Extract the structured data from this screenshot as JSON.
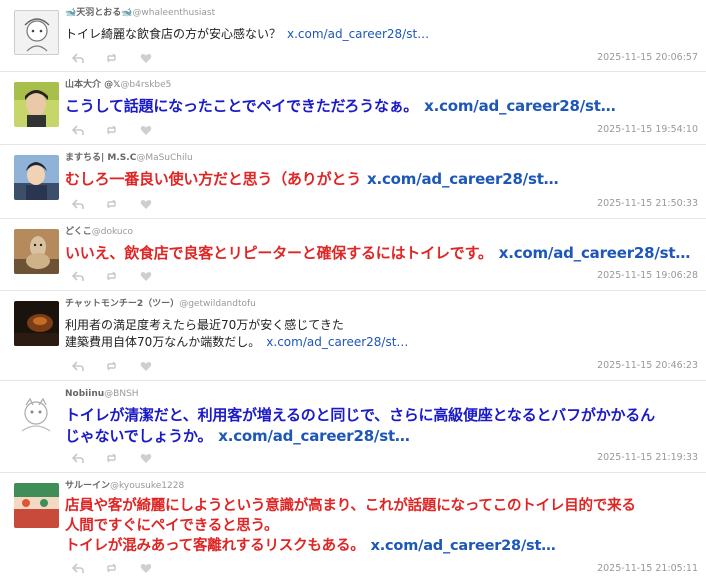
{
  "tweets": [
    {
      "display_name": "🐋天羽とおる🐋",
      "handle": "@whaleenthusiast",
      "lines": [
        "トイレ綺麗な飲食店の方が安心感ない？"
      ],
      "link": "x.com/ad_career28/st…",
      "timestamp": "2025-11-15 20:06:57"
    },
    {
      "display_name": "山本大介 @𝕏",
      "handle": "@b4rskbe5",
      "lines": [
        "こうして話題になったことでペイできただろうなぁ。"
      ],
      "link": "x.com/ad_career28/st…",
      "timestamp": "2025-11-15 19:54:10"
    },
    {
      "display_name": "ますちる| M.S.C",
      "handle": "@MaSuChilu",
      "lines": [
        "むしろ一番良い使い方だと思う（ありがとう"
      ],
      "link": "x.com/ad_career28/st…",
      "timestamp": "2025-11-15 21:50:33"
    },
    {
      "display_name": "どくこ",
      "handle": "@dokuco",
      "lines": [
        "いいえ、飲食店で良客とリピーターと確保するにはトイレです。"
      ],
      "link": "x.com/ad_career28/st…",
      "timestamp": "2025-11-15 19:06:28"
    },
    {
      "display_name": "チャットモンチー2（ツー）",
      "handle": "@getwildandtofu",
      "lines": [
        "利用者の満足度考えたら最近70万が安く感じてきた",
        "建築費用自体70万なんか端数だし。"
      ],
      "link": "x.com/ad_career28/st…",
      "timestamp": "2025-11-15 20:46:23"
    },
    {
      "display_name": "Nobiinu",
      "handle": "@BNSH",
      "lines": [
        "トイレが清潔だと、利用客が増えるのと同じで、さらに高級便座となるとバフがかかるん",
        "じゃないでしょうか。"
      ],
      "link": "x.com/ad_career28/st…",
      "timestamp": "2025-11-15 21:19:33"
    },
    {
      "display_name": "サルーイン",
      "handle": "@kyousuke1228",
      "lines": [
        "店員や客が綺麗にしようという意識が高まり、これが話題になってこのトイレ目的で来る",
        "人間ですぐにペイできると思う。",
        "トイレが混みあって客離れするリスクもある。"
      ],
      "link": "x.com/ad_career28/st…",
      "timestamp": "2025-11-15 21:05:11"
    }
  ],
  "colors": {
    "link": "#1d57b8",
    "emphasis_blue": "#1a1ac8",
    "emphasis_red": "#e02525",
    "meta_gray": "#999999"
  },
  "icons": {
    "reply": "reply-icon",
    "retweet": "retweet-icon",
    "like": "heart-icon"
  }
}
